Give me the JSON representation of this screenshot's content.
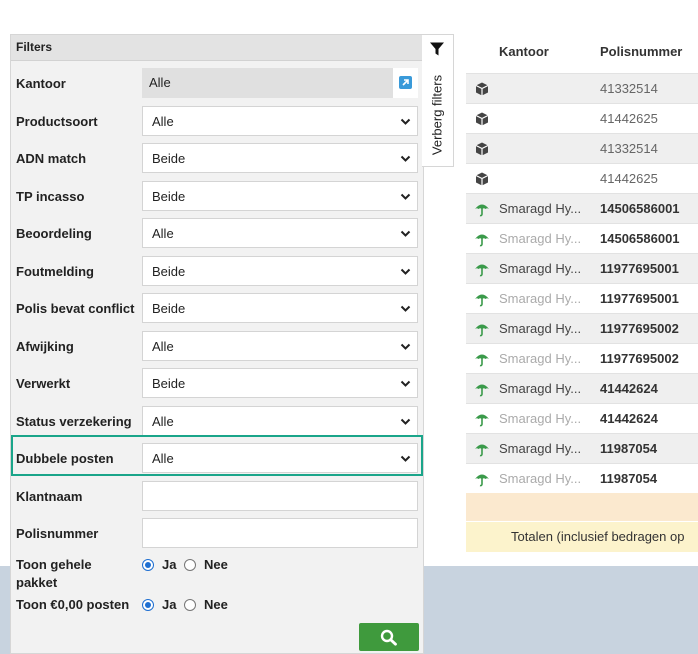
{
  "filters": {
    "title": "Filters",
    "rows": [
      {
        "label": "Kantoor",
        "value": "Alle"
      },
      {
        "label": "Productsoort",
        "value": "Alle"
      },
      {
        "label": "ADN match",
        "value": "Beide"
      },
      {
        "label": "TP incasso",
        "value": "Beide"
      },
      {
        "label": "Beoordeling",
        "value": "Alle"
      },
      {
        "label": "Foutmelding",
        "value": "Beide"
      },
      {
        "label": "Polis bevat conflict",
        "value": "Beide"
      },
      {
        "label": "Afwijking",
        "value": "Alle"
      },
      {
        "label": "Verwerkt",
        "value": "Beide"
      },
      {
        "label": "Status verzekering",
        "value": "Alle"
      },
      {
        "label": "Dubbele posten",
        "value": "Alle"
      }
    ],
    "klantnaam": {
      "label": "Klantnaam",
      "value": ""
    },
    "polisnummer": {
      "label": "Polisnummer",
      "value": ""
    },
    "toon_pakket": {
      "label_line1": "Toon gehele",
      "label_line2": "pakket",
      "yes": "Ja",
      "no": "Nee",
      "selected": "Ja"
    },
    "toon_nul": {
      "label": "Toon €0,00 posten",
      "yes": "Ja",
      "no": "Nee",
      "selected": "Ja"
    },
    "search_icon": "search-icon"
  },
  "toggle": {
    "label": "Verberg filters",
    "icon": "filter-funnel-icon"
  },
  "table": {
    "headers": {
      "kantoor": "Kantoor",
      "polisnummer": "Polisnummer"
    },
    "rows": [
      {
        "icon": "package-icon",
        "kantoor": "",
        "polisnummer": "41332514"
      },
      {
        "icon": "package-icon",
        "kantoor": "",
        "polisnummer": "41442625"
      },
      {
        "icon": "package-icon",
        "kantoor": "",
        "polisnummer": "41332514"
      },
      {
        "icon": "package-icon",
        "kantoor": "",
        "polisnummer": "41442625"
      },
      {
        "icon": "umbrella-icon",
        "kantoor": "Smaragd Hy...",
        "polisnummer": "14506586001"
      },
      {
        "icon": "umbrella-icon",
        "kantoor": "Smaragd Hy...",
        "polisnummer": "14506586001"
      },
      {
        "icon": "umbrella-icon",
        "kantoor": "Smaragd Hy...",
        "polisnummer": "11977695001"
      },
      {
        "icon": "umbrella-icon",
        "kantoor": "Smaragd Hy...",
        "polisnummer": "11977695001"
      },
      {
        "icon": "umbrella-icon",
        "kantoor": "Smaragd Hy...",
        "polisnummer": "11977695002"
      },
      {
        "icon": "umbrella-icon",
        "kantoor": "Smaragd Hy...",
        "polisnummer": "11977695002"
      },
      {
        "icon": "umbrella-icon",
        "kantoor": "Smaragd Hy...",
        "polisnummer": "41442624"
      },
      {
        "icon": "umbrella-icon",
        "kantoor": "Smaragd Hy...",
        "polisnummer": "41442624"
      },
      {
        "icon": "umbrella-icon",
        "kantoor": "Smaragd Hy...",
        "polisnummer": "11987054"
      },
      {
        "icon": "umbrella-icon",
        "kantoor": "Smaragd Hy...",
        "polisnummer": "11987054"
      }
    ],
    "totals_label": "Totalen (inclusief bedragen op"
  },
  "colors": {
    "highlight": "#1aa58a",
    "search_button": "#3f9a3d",
    "umbrella": "#3a9a4a",
    "radio": "#1f6fd1"
  }
}
